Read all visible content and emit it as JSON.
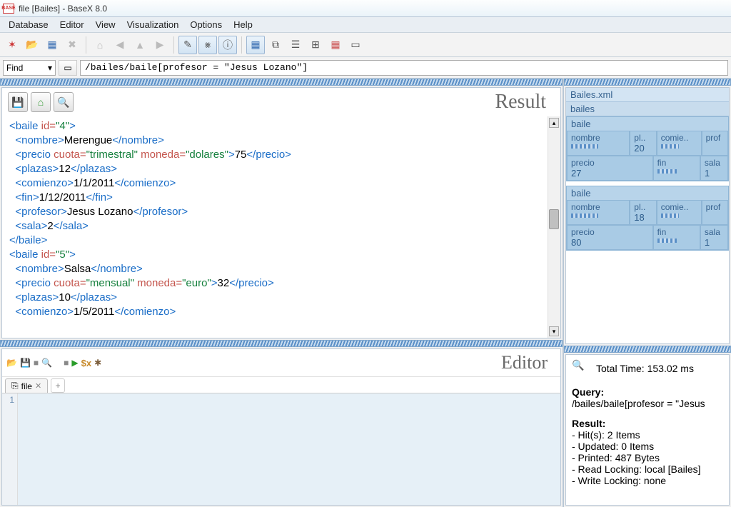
{
  "window": {
    "title": "file [Bailes] - BaseX 8.0"
  },
  "menu": {
    "database": "Database",
    "editor": "Editor",
    "view": "View",
    "visualization": "Visualization",
    "options": "Options",
    "help": "Help"
  },
  "find": {
    "label": "Find",
    "query": "/bailes/baile[profesor = \"Jesus Lozano\"]"
  },
  "result": {
    "title": "Result",
    "xml": [
      {
        "t": "tag",
        "v": "<baile "
      },
      {
        "t": "attr",
        "v": "id="
      },
      {
        "t": "val",
        "v": "\"4\""
      },
      {
        "t": "tag",
        "v": ">"
      },
      {
        "t": "nl"
      },
      {
        "t": "ind"
      },
      {
        "t": "tag",
        "v": "<nombre>"
      },
      {
        "t": "txt",
        "v": "Merengue"
      },
      {
        "t": "tag",
        "v": "</nombre>"
      },
      {
        "t": "nl"
      },
      {
        "t": "ind"
      },
      {
        "t": "tag",
        "v": "<precio "
      },
      {
        "t": "attr",
        "v": "cuota="
      },
      {
        "t": "val",
        "v": "\"trimestral\""
      },
      {
        "t": "txt",
        "v": " "
      },
      {
        "t": "attr",
        "v": "moneda="
      },
      {
        "t": "val",
        "v": "\"dolares\""
      },
      {
        "t": "tag",
        "v": ">"
      },
      {
        "t": "txt",
        "v": "75"
      },
      {
        "t": "tag",
        "v": "</precio>"
      },
      {
        "t": "nl"
      },
      {
        "t": "ind"
      },
      {
        "t": "tag",
        "v": "<plazas>"
      },
      {
        "t": "txt",
        "v": "12"
      },
      {
        "t": "tag",
        "v": "</plazas>"
      },
      {
        "t": "nl"
      },
      {
        "t": "ind"
      },
      {
        "t": "tag",
        "v": "<comienzo>"
      },
      {
        "t": "txt",
        "v": "1/1/2011"
      },
      {
        "t": "tag",
        "v": "</comienzo>"
      },
      {
        "t": "nl"
      },
      {
        "t": "ind"
      },
      {
        "t": "tag",
        "v": "<fin>"
      },
      {
        "t": "txt",
        "v": "1/12/2011"
      },
      {
        "t": "tag",
        "v": "</fin>"
      },
      {
        "t": "nl"
      },
      {
        "t": "ind"
      },
      {
        "t": "tag",
        "v": "<profesor>"
      },
      {
        "t": "txt",
        "v": "Jesus Lozano"
      },
      {
        "t": "tag",
        "v": "</profesor>"
      },
      {
        "t": "nl"
      },
      {
        "t": "ind"
      },
      {
        "t": "tag",
        "v": "<sala>"
      },
      {
        "t": "txt",
        "v": "2"
      },
      {
        "t": "tag",
        "v": "</sala>"
      },
      {
        "t": "nl"
      },
      {
        "t": "tag",
        "v": "</baile>"
      },
      {
        "t": "nl"
      },
      {
        "t": "tag",
        "v": "<baile "
      },
      {
        "t": "attr",
        "v": "id="
      },
      {
        "t": "val",
        "v": "\"5\""
      },
      {
        "t": "tag",
        "v": ">"
      },
      {
        "t": "nl"
      },
      {
        "t": "ind"
      },
      {
        "t": "tag",
        "v": "<nombre>"
      },
      {
        "t": "txt",
        "v": "Salsa"
      },
      {
        "t": "tag",
        "v": "</nombre>"
      },
      {
        "t": "nl"
      },
      {
        "t": "ind"
      },
      {
        "t": "tag",
        "v": "<precio "
      },
      {
        "t": "attr",
        "v": "cuota="
      },
      {
        "t": "val",
        "v": "\"mensual\""
      },
      {
        "t": "txt",
        "v": " "
      },
      {
        "t": "attr",
        "v": "moneda="
      },
      {
        "t": "val",
        "v": "\"euro\""
      },
      {
        "t": "tag",
        "v": ">"
      },
      {
        "t": "txt",
        "v": "32"
      },
      {
        "t": "tag",
        "v": "</precio>"
      },
      {
        "t": "nl"
      },
      {
        "t": "ind"
      },
      {
        "t": "tag",
        "v": "<plazas>"
      },
      {
        "t": "txt",
        "v": "10"
      },
      {
        "t": "tag",
        "v": "</plazas>"
      },
      {
        "t": "nl"
      },
      {
        "t": "ind"
      },
      {
        "t": "tag",
        "v": "<comienzo>"
      },
      {
        "t": "txt",
        "v": "1/5/2011"
      },
      {
        "t": "tag",
        "v": "</comienzo>"
      },
      {
        "t": "nl"
      }
    ]
  },
  "editor": {
    "title": "Editor",
    "tab": "file",
    "gutter1": "1"
  },
  "treemap": {
    "file": "Bailes.xml",
    "root": "bailes",
    "bailes": [
      {
        "label": "baile",
        "nombre": {
          "lbl": "nombre"
        },
        "pl": {
          "lbl": "pl..",
          "val": "20"
        },
        "comie": {
          "lbl": "comie.."
        },
        "prof": {
          "lbl": "prof"
        },
        "precio": {
          "lbl": "precio",
          "val": "27"
        },
        "fin": {
          "lbl": "fin"
        },
        "sala": {
          "lbl": "sala",
          "val": "1"
        }
      },
      {
        "label": "baile",
        "nombre": {
          "lbl": "nombre"
        },
        "pl": {
          "lbl": "pl..",
          "val": "18"
        },
        "comie": {
          "lbl": "comie.."
        },
        "prof": {
          "lbl": "prof"
        },
        "precio": {
          "lbl": "precio",
          "val": "80"
        },
        "fin": {
          "lbl": "fin"
        },
        "sala": {
          "lbl": "sala",
          "val": "1"
        }
      }
    ]
  },
  "info": {
    "totaltime_label": "Total Time:",
    "totaltime": "153.02 ms",
    "query_label": "Query:",
    "query": "/bailes/baile[profesor = \"Jesus",
    "result_label": "Result:",
    "hits": "- Hit(s): 2 Items",
    "updated": "- Updated: 0 Items",
    "printed": "- Printed: 487 Bytes",
    "readlock": "- Read Locking: local [Bailes]",
    "writelock": "- Write Locking: none"
  }
}
